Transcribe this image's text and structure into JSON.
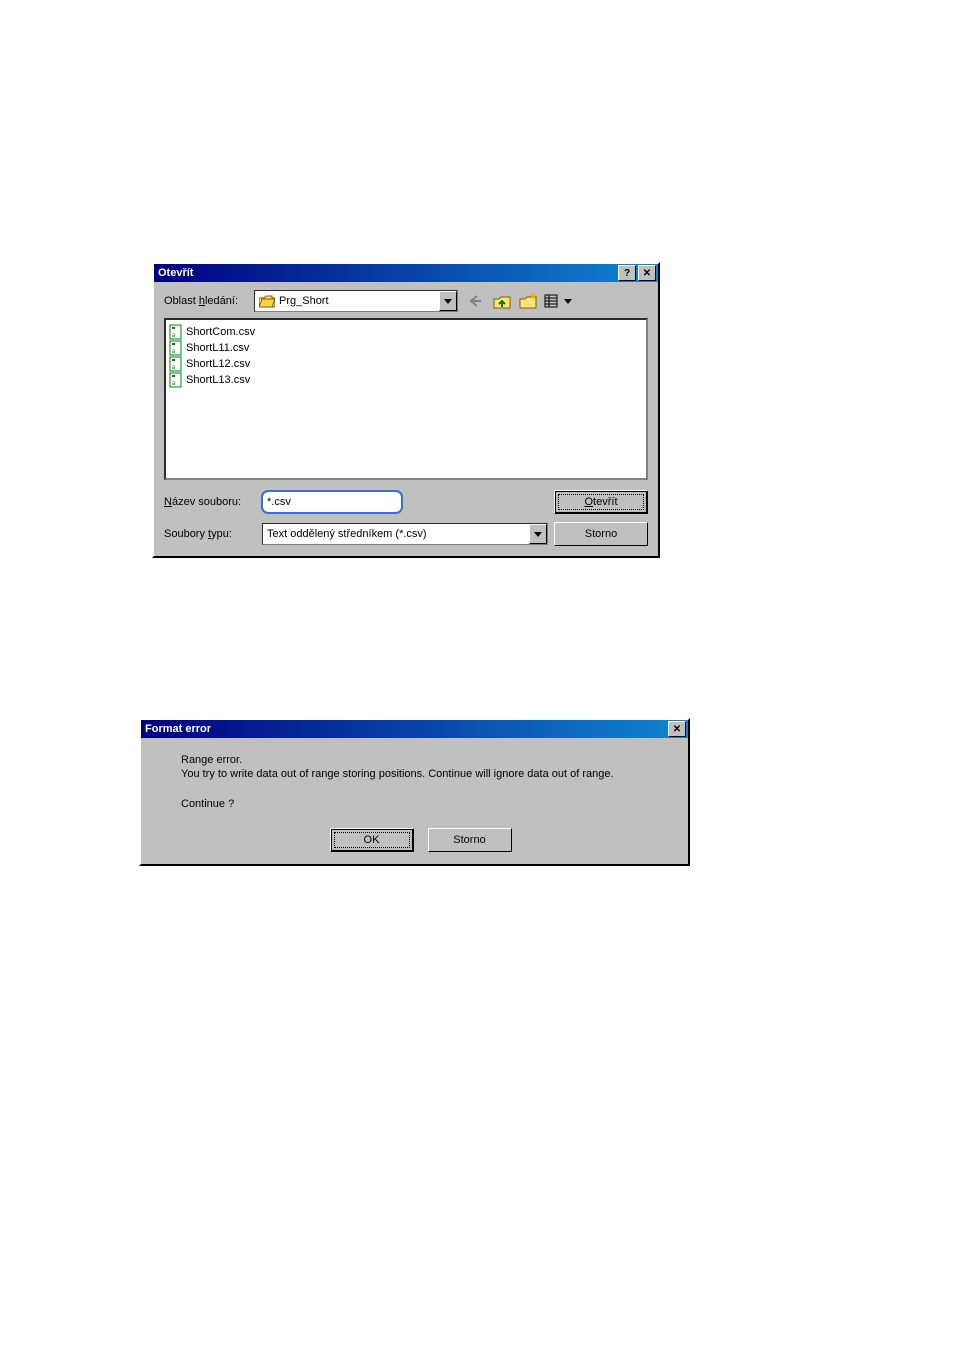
{
  "open_dialog": {
    "title": "Otevřít",
    "lookin_label_pre": "Oblast ",
    "lookin_label_u": "h",
    "lookin_label_post": "ledání:",
    "folder_name": "Prg_Short",
    "files": [
      "ShortCom.csv",
      "ShortL11.csv",
      "ShortL12.csv",
      "ShortL13.csv"
    ],
    "filename_label_u": "N",
    "filename_label_rest": "ázev souboru:",
    "filename_value": "*.csv",
    "filetype_label_pre": "Soubory ",
    "filetype_label_u": "t",
    "filetype_label_post": "ypu:",
    "filetype_value": "Text oddělený středníkem (*.csv)",
    "open_btn_u": "O",
    "open_btn_rest": "tevřít",
    "cancel_btn": "Storno",
    "icons": {
      "back": "back-arrow-icon",
      "up": "up-one-level-icon",
      "newfolder": "new-folder-icon",
      "views": "views-icon"
    }
  },
  "error_dialog": {
    "title": "Format error",
    "line1": "Range error.",
    "line2": "You try to write data out of range storing positions. Continue will ignore data out of range.",
    "question": "Continue ?",
    "ok": "OK",
    "cancel": "Storno"
  }
}
